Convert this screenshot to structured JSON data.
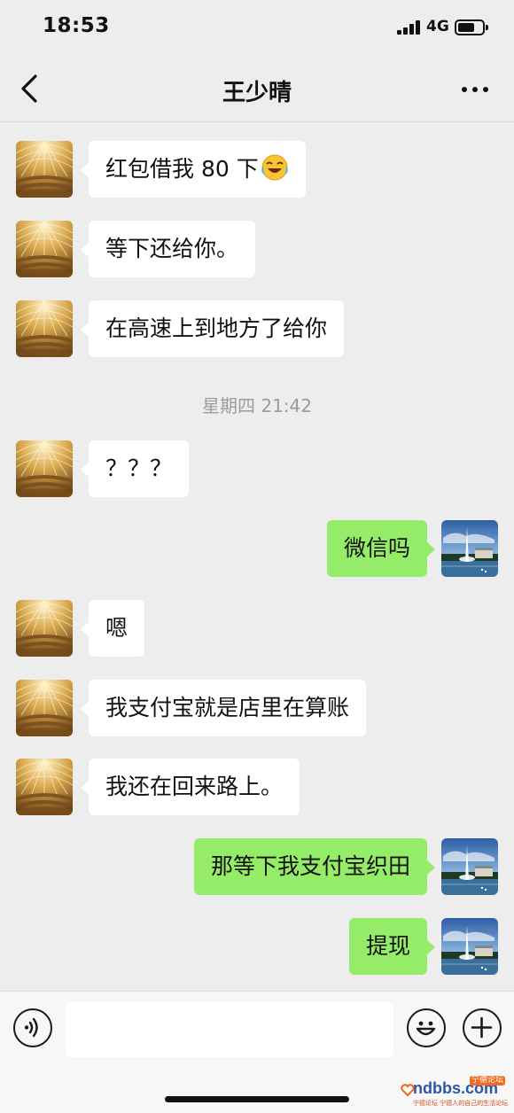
{
  "status_bar": {
    "time": "18:53",
    "network": "4G"
  },
  "header": {
    "title": "王少晴"
  },
  "messages": [
    {
      "side": "left",
      "text": "红包借我 80 下",
      "emoji": "laughing-crying-emoji"
    },
    {
      "side": "left",
      "text": "等下还给你。"
    },
    {
      "side": "left",
      "text": "在高速上到地方了给你"
    },
    {
      "side": "left",
      "text": "？？？"
    },
    {
      "side": "right",
      "text": "微信吗"
    },
    {
      "side": "left",
      "text": "嗯"
    },
    {
      "side": "left",
      "text": "我支付宝就是店里在算账"
    },
    {
      "side": "left",
      "text": "我还在回来路上。"
    },
    {
      "side": "right",
      "text": "那等下我支付宝织田"
    },
    {
      "side": "right",
      "text": "提现"
    }
  ],
  "timestamp": "星期四 21:42",
  "input_bar": {
    "placeholder": ""
  },
  "watermark": {
    "brand": "ndbbs.com",
    "tag": "宁德论坛",
    "subtitle": "宁德论坛 宁德人的自己的生活论坛"
  },
  "colors": {
    "background": "#ededed",
    "received_bubble": "#ffffff",
    "sent_bubble": "#95ec69",
    "timestamp_text": "#9c9c9c"
  }
}
